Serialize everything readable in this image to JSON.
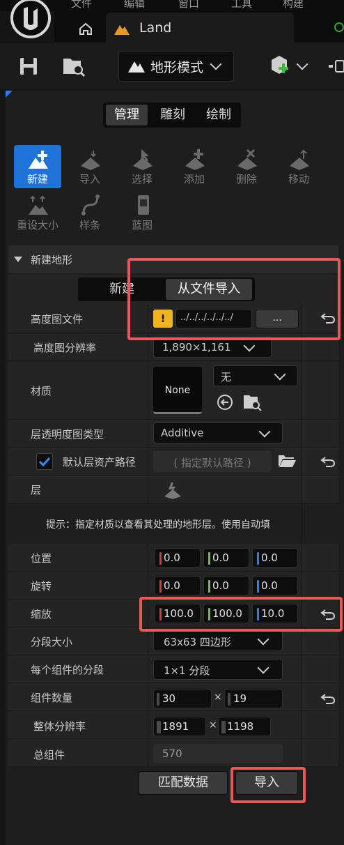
{
  "menu": {
    "items": [
      "文件",
      "编辑",
      "窗口",
      "工具",
      "构建"
    ]
  },
  "tabs": {
    "doc_label": "Land"
  },
  "toolbar": {
    "mode_label": "地形模式"
  },
  "mode_tabs": [
    "管理",
    "雕刻",
    "绘制"
  ],
  "tools": {
    "row1": [
      "新建",
      "导入",
      "选择",
      "添加",
      "删除",
      "移动"
    ],
    "row2": [
      "重设大小",
      "样条",
      "蓝图"
    ]
  },
  "section": {
    "title": "新建地形"
  },
  "new_tabs": {
    "new": "新建",
    "import": "从文件导入"
  },
  "fields": {
    "heightmap_label": "高度图文件",
    "heightmap_warn": "!",
    "heightmap_path": "../../../../../../",
    "heightmap_browse": "...",
    "resolution_label": "高度图分辨率",
    "resolution_value": "1,890×1,161",
    "material_label": "材质",
    "material_thumb": "None",
    "material_value": "无",
    "layer_type_label": "层透明度图类型",
    "layer_type_value": "Additive",
    "default_path_label": "默认层资产路径",
    "default_path_value": "( 指定默认路径 )",
    "layer_label": "层",
    "hint": "提示：指定材质以查看其处理的地形层。使用自动填",
    "location_label": "位置",
    "location": [
      "0.0",
      "0.0",
      "0.0"
    ],
    "rotation_label": "旋转",
    "rotation": [
      "0.0",
      "0.0",
      "0.0"
    ],
    "scale_label": "缩放",
    "scale": [
      "100.0",
      "100.0",
      "10.0"
    ],
    "section_size_label": "分段大小",
    "section_size_value": "63x63 四边形",
    "sections_per_comp_label": "每个组件的分段",
    "sections_per_comp_value": "1×1 分段",
    "comp_count_label": "组件数量",
    "comp_count": [
      "30",
      "19"
    ],
    "overall_res_label": "整体分辨率",
    "overall_res": [
      "1891",
      "1198"
    ],
    "total_comp_label": "总组件",
    "total_comp_value": "570",
    "times": "×"
  },
  "buttons": {
    "fit_data": "匹配数据",
    "import": "导入"
  },
  "colors": {
    "accent": "#1f72d8",
    "highlight": "#e8595a",
    "x_axis": "#d43a3a",
    "y_axis": "#6ec23a",
    "z_axis": "#2f7fe0"
  }
}
